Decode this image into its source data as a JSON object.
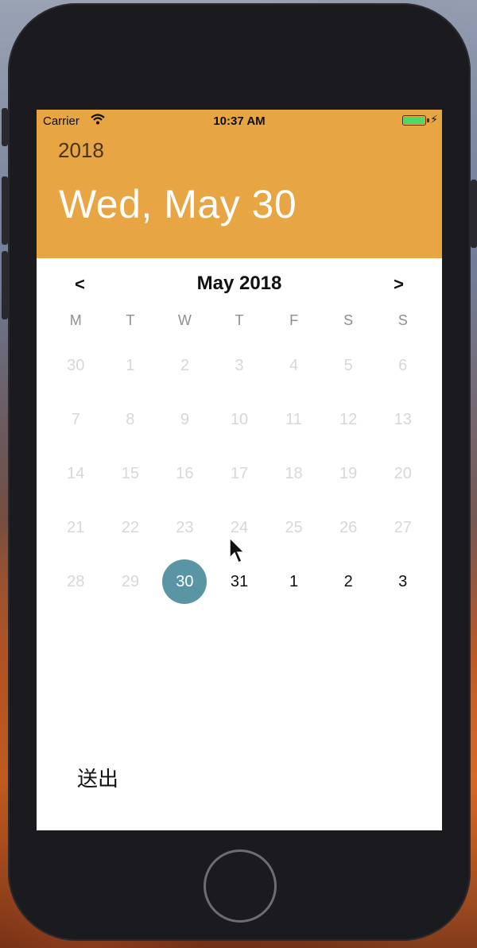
{
  "status_bar": {
    "carrier": "Carrier",
    "time": "10:37 AM"
  },
  "header": {
    "year": "2018",
    "selected_date": "Wed, May 30"
  },
  "calendar": {
    "month_title": "May 2018",
    "prev_label": "<",
    "next_label": ">",
    "weekdays": [
      "M",
      "T",
      "W",
      "T",
      "F",
      "S",
      "S"
    ],
    "days": [
      "30",
      "1",
      "2",
      "3",
      "4",
      "5",
      "6",
      "7",
      "8",
      "9",
      "10",
      "11",
      "12",
      "13",
      "14",
      "15",
      "16",
      "17",
      "18",
      "19",
      "20",
      "21",
      "22",
      "23",
      "24",
      "25",
      "26",
      "27",
      "28",
      "29",
      "30",
      "31",
      "1",
      "2",
      "3"
    ]
  },
  "submit_label": "送出",
  "colors": {
    "header_bg": "#e8a543",
    "selected_circle": "#5a95a6",
    "disabled_day": "#d7d7da"
  }
}
